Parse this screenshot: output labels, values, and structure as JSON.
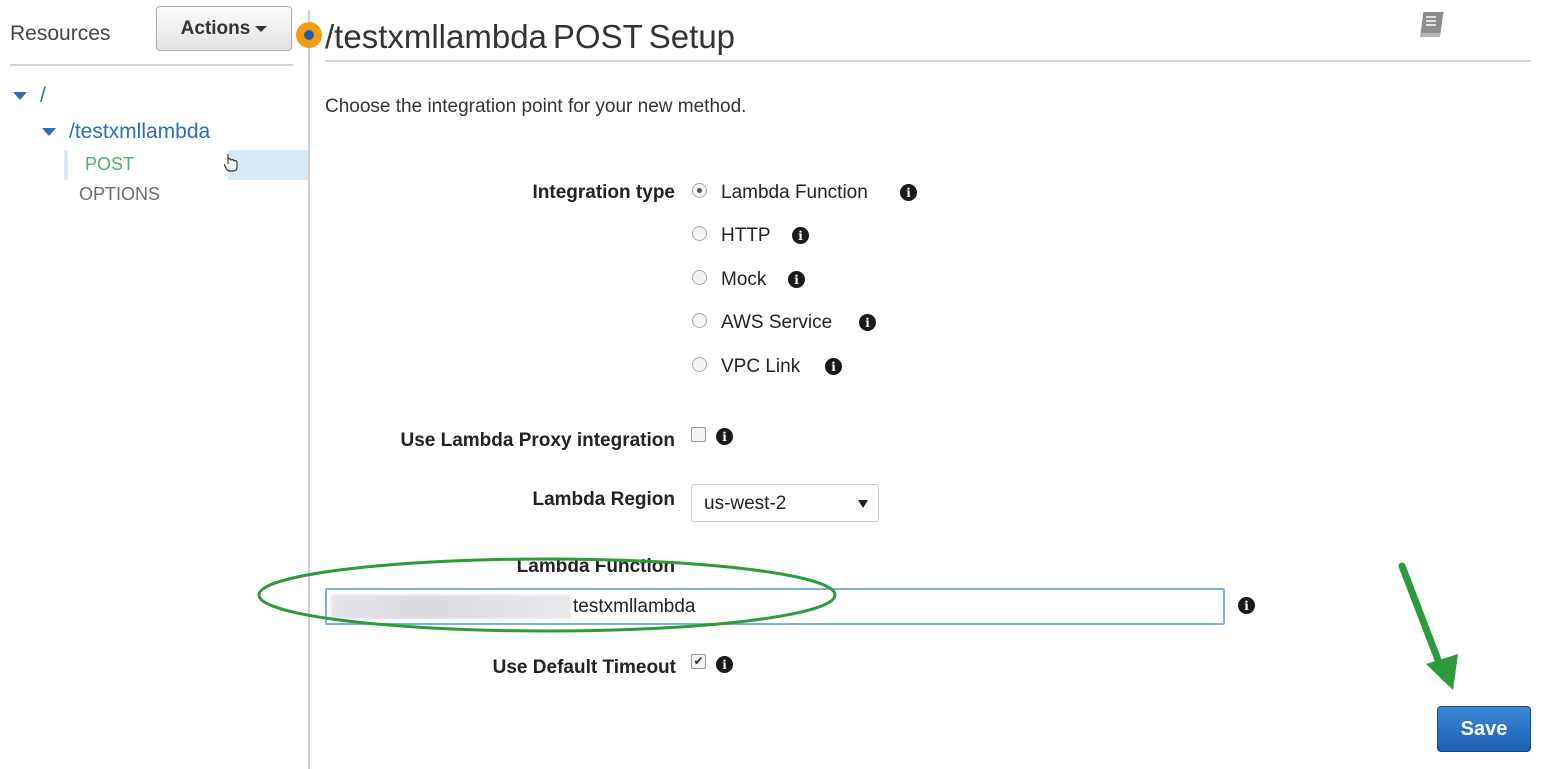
{
  "sidebar": {
    "title": "Resources",
    "actions_label": "Actions",
    "tree": {
      "root": "/",
      "resource": "/testxmllambda",
      "methods": [
        "POST",
        "OPTIONS"
      ]
    }
  },
  "header": {
    "path": "/testxmllambda",
    "method": "POST",
    "suffix": "Setup"
  },
  "intro_text": "Choose the integration point for your new method.",
  "form": {
    "integration_type_label": "Integration type",
    "integration_options": [
      "Lambda Function",
      "HTTP",
      "Mock",
      "AWS Service",
      "VPC Link"
    ],
    "integration_selected": "Lambda Function",
    "proxy_label": "Use Lambda Proxy integration",
    "proxy_checked": false,
    "region_label": "Lambda Region",
    "region_value": "us-west-2",
    "function_label": "Lambda Function",
    "function_value": "testxmllambda",
    "timeout_label": "Use Default Timeout",
    "timeout_checked": true
  },
  "save_label": "Save",
  "colors": {
    "link": "#2a6ebb",
    "method_post": "#4caf6e",
    "annotation": "#2e9b3a",
    "save_button": "#1d5fb2",
    "status_dot": "#f39c12"
  },
  "icons": [
    "book-icon",
    "info-icon",
    "hand-cursor-icon",
    "caret-down-icon",
    "status-dot-icon"
  ]
}
